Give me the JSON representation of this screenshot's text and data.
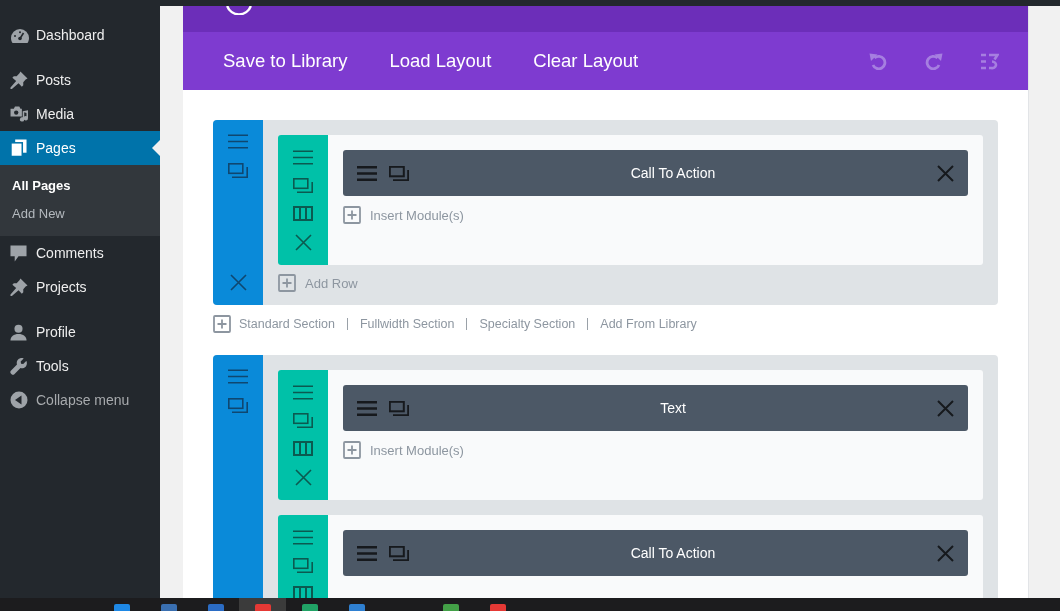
{
  "sidebar": {
    "menu_groups": [
      {
        "items": [
          {
            "label": "Dashboard",
            "selected": false
          }
        ]
      },
      {
        "items": [
          {
            "label": "Posts",
            "selected": false
          },
          {
            "label": "Media",
            "selected": false
          },
          {
            "label": "Pages",
            "selected": true,
            "children": [
              {
                "label": "All Pages",
                "selected": true
              },
              {
                "label": "Add New",
                "selected": false
              }
            ]
          },
          {
            "label": "Comments",
            "selected": false
          },
          {
            "label": "Projects",
            "selected": false
          }
        ]
      },
      {
        "items": [
          {
            "label": "Profile",
            "selected": false
          },
          {
            "label": "Tools",
            "selected": false
          }
        ]
      }
    ],
    "collapse_menu": "Collapse menu"
  },
  "builder": {
    "toolbar": {
      "buttons": [
        "Save to Library",
        "Load Layout",
        "Clear Layout"
      ],
      "history_buttons": [
        {
          "disabled": true
        },
        {
          "disabled": true
        },
        {
          "disabled": true
        }
      ]
    },
    "sections": [
      {
        "rows": [
          {
            "modules": [
              {
                "title": "Call To Action"
              }
            ],
            "insert_label": "Insert Module(s)"
          }
        ],
        "add_row": "Add Row",
        "add_section_links": [
          "Standard Section",
          "Fullwidth Section",
          "Specialty Section",
          "Add From Library"
        ]
      },
      {
        "rows": [
          {
            "modules": [
              {
                "title": "Text"
              }
            ],
            "insert_label": "Insert Module(s)"
          },
          {
            "modules": [
              {
                "title": "Call To Action"
              }
            ]
          }
        ]
      }
    ]
  },
  "taskbar": {
    "apps": [
      {
        "selected": false
      },
      {
        "selected": false
      },
      {
        "selected": false
      },
      {
        "selected": true
      },
      {
        "selected": false
      },
      {
        "selected": false
      },
      {
        "selected": false
      },
      {
        "selected": false
      }
    ]
  }
}
